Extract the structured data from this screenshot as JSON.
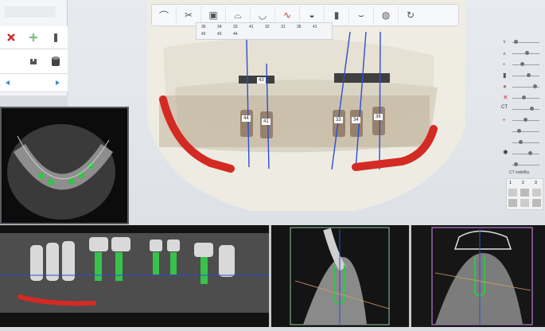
{
  "palette": {
    "icons": [
      "close-icon",
      "plus-icon",
      "implant-icon",
      "abutment-icon",
      "cylinder-icon",
      "arrow-left-icon",
      "arrow-right-icon"
    ]
  },
  "toolbar": {
    "icons": [
      "jaw-icon",
      "pliers-icon",
      "scan-icon",
      "crown-icon",
      "arch-icon",
      "curve-icon",
      "tooth-icon",
      "implant-icon",
      "teeth-icon",
      "sphere-icon",
      "refresh-icon"
    ]
  },
  "implant_list": {
    "row1": [
      "36",
      "34",
      "33",
      "41",
      "32",
      "31",
      "35",
      "41"
    ],
    "row2": [
      "42",
      "43",
      "44"
    ]
  },
  "viewport": {
    "implant_labels": [
      "43",
      "44",
      "41",
      "33",
      "34",
      "36"
    ],
    "ct_label": "CT"
  },
  "right_panel": {
    "ct_visibility_label": "CT visibility",
    "numbers": [
      "1",
      "2",
      "3"
    ]
  },
  "colors": {
    "nerve": "#d42a24",
    "implant_axis": "#2b4fd1",
    "implant_green": "#37c24a",
    "cross1_border": "#8fc7a0",
    "cross2_border": "#b27ad0"
  }
}
